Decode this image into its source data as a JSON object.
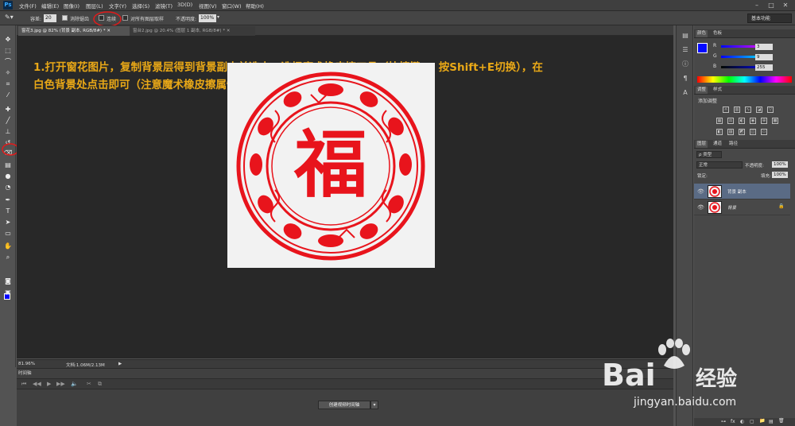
{
  "app": {
    "logo": "Ps"
  },
  "menubar": {
    "items": [
      "文件(F)",
      "编辑(E)",
      "图像(I)",
      "图层(L)",
      "文字(Y)",
      "选择(S)",
      "滤镜(T)",
      "3D(D)",
      "视图(V)",
      "窗口(W)",
      "帮助(H)"
    ]
  },
  "window_controls": {
    "minimize": "–",
    "restore": "□",
    "close": "✕"
  },
  "options": {
    "size_label": "容差:",
    "size_value": "20",
    "antialias_label": "消除锯齿",
    "contiguous_label": "连续",
    "sample_all_label": "对所有图层取样",
    "opacity_label": "不透明度:",
    "opacity_value": "100%",
    "workspace": "基本功能"
  },
  "tabs": [
    {
      "label": "窗花3.jpg @ 82% (背景 副本, RGB/8#) * ✕"
    },
    {
      "label": "窗台2.jpg @ 20.4% (图层 1 副本, RGB/8#) * ✕"
    }
  ],
  "instruction": {
    "line1": "1.打开窗花图片，复制背景层得到背景副本并选中，选择魔术橡皮擦工具（快捷键E，按Shift+E切换），在",
    "line2": "白色背景处点击即可（注意魔术橡皮擦属性栏的连续前面的✓要去掉）。"
  },
  "artwork": {
    "center_char": "福",
    "color": "#e8141c"
  },
  "status": {
    "zoom": "81.96%",
    "doc_label": "文档:1.06M/2.13M",
    "arrow": "▶"
  },
  "timeline": {
    "tab": "时间轴",
    "create_button": "创建视频时间轴",
    "controls": [
      "⏮",
      "◀◀",
      "▶",
      "▶▶",
      "🔈",
      "✂",
      "⧉"
    ]
  },
  "color_panel": {
    "tabs": [
      "颜色",
      "色板"
    ],
    "channels": [
      {
        "label": "R",
        "value": "3"
      },
      {
        "label": "G",
        "value": "9"
      },
      {
        "label": "B",
        "value": "255"
      }
    ],
    "foreground": "#0309ff"
  },
  "adjust_panel": {
    "tabs": [
      "调整",
      "样式"
    ],
    "title": "添加调整"
  },
  "layers_panel": {
    "tabs": [
      "图层",
      "通道",
      "路径"
    ],
    "filter_label": "ρ 类型",
    "blend_mode": "正常",
    "opacity_label": "不透明度:",
    "opacity_value": "100%",
    "lock_label": "锁定:",
    "fill_label": "填充:",
    "fill_value": "100%",
    "layers": [
      {
        "name": "背景 副本",
        "selected": true
      },
      {
        "name": "背景",
        "selected": false
      }
    ],
    "footer_icons": [
      "fx",
      "◐",
      "▢",
      "📁",
      "▤",
      "🗑"
    ]
  },
  "watermark": {
    "brand": "Bai",
    "brand2": "经验",
    "url": "jingyan.baidu.com"
  },
  "colors": {
    "accent_red": "#e8141c",
    "instruction": "#e9a817",
    "annotation": "#e21a1a"
  }
}
